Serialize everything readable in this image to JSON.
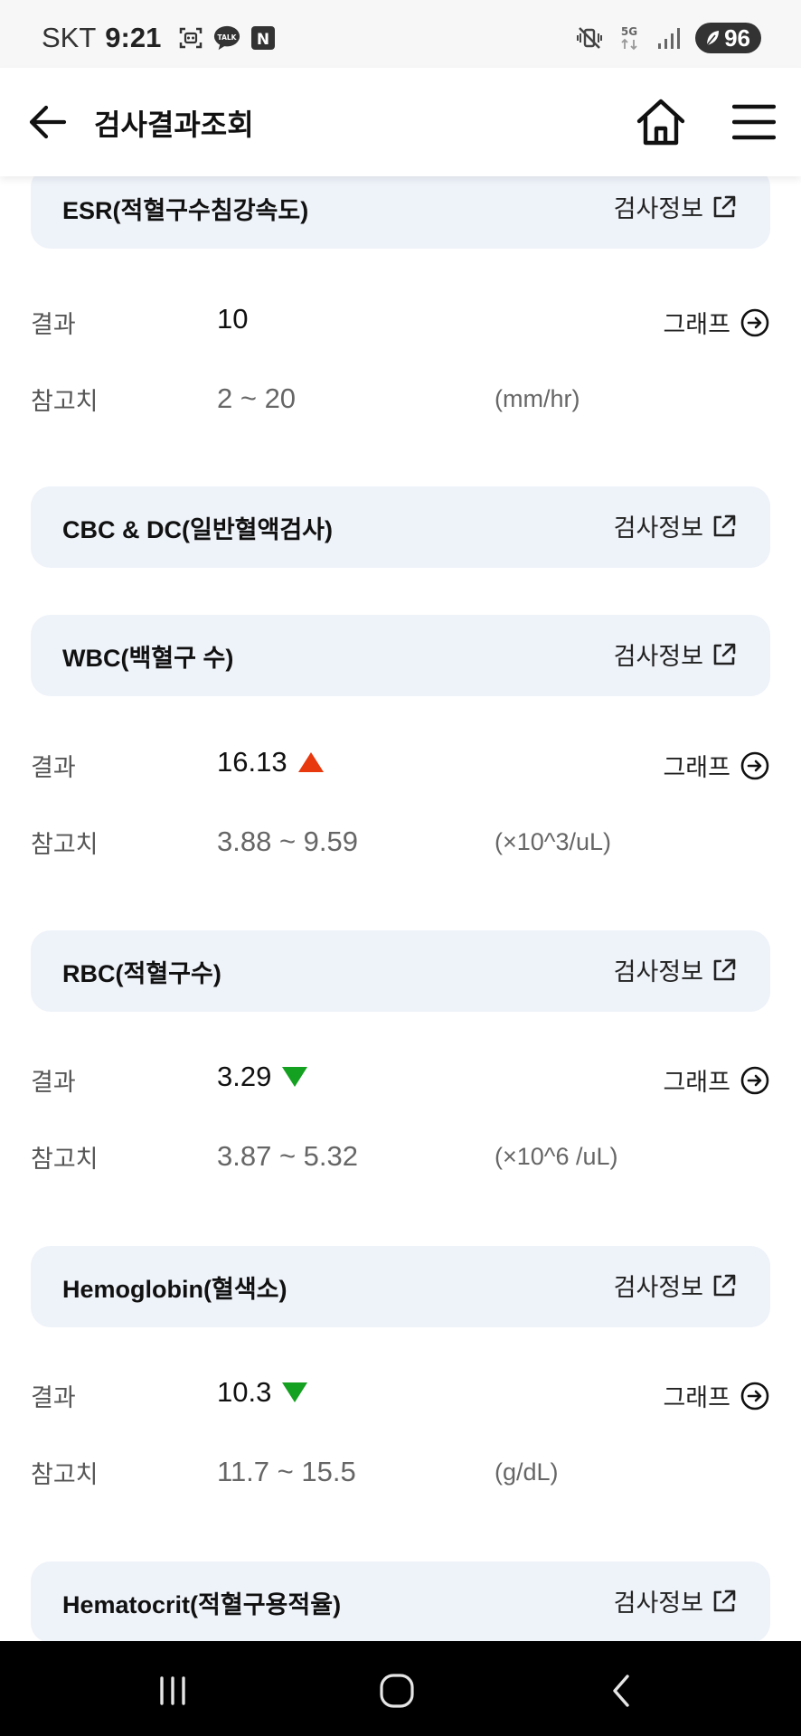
{
  "status_bar": {
    "carrier": "SKT",
    "time": "9:21",
    "talk_label": "TALK",
    "n_label": "N",
    "network": "5G",
    "battery": "96"
  },
  "header": {
    "title": "검사결과조회"
  },
  "labels": {
    "result": "결과",
    "reference": "참고치",
    "graph": "그래프",
    "info": "검사정보"
  },
  "colors": {
    "card_bg": "#eef2f9",
    "high_arrow": "#e8380d",
    "low_arrow": "#14a020"
  },
  "tests": [
    {
      "title": "ESR(적혈구수침강속도)",
      "result": "10",
      "flag": "",
      "range": "2 ~ 20",
      "unit": "(mm/hr)"
    },
    {
      "title": "CBC & DC(일반혈액검사)"
    },
    {
      "title": "WBC(백혈구 수)",
      "result": "16.13",
      "flag": "high",
      "range": "3.88 ~ 9.59",
      "unit": "(×10^3/uL)"
    },
    {
      "title": "RBC(적혈구수)",
      "result": "3.29",
      "flag": "low",
      "range": "3.87 ~ 5.32",
      "unit": "(×10^6 /uL)"
    },
    {
      "title": "Hemoglobin(혈색소)",
      "result": "10.3",
      "flag": "low",
      "range": "11.7 ~ 15.5",
      "unit": "(g/dL)"
    },
    {
      "title": "Hematocrit(적혈구용적율)"
    }
  ]
}
